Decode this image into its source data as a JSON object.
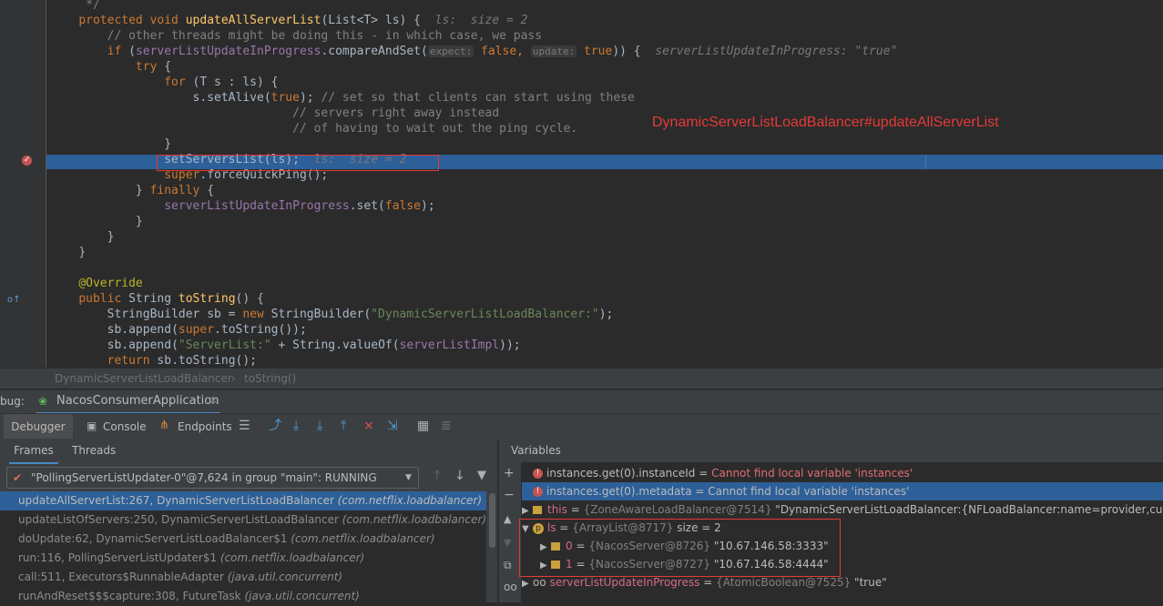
{
  "editor": {
    "lines": [
      {
        "indent": "     ",
        "parts": [
          {
            "t": "*/",
            "c": "cmt"
          }
        ]
      },
      {
        "indent": "    ",
        "parts": [
          {
            "t": "protected void ",
            "c": "kw"
          },
          {
            "t": "updateAllServerList",
            "c": "fn"
          },
          {
            "t": "(List<T> ls) {  ",
            "c": ""
          },
          {
            "t": "ls:  size = 2",
            "c": "inl"
          }
        ]
      },
      {
        "indent": "        ",
        "parts": [
          {
            "t": "// other threads might be doing this - in which case, we pass",
            "c": "cmt"
          }
        ]
      },
      {
        "indent": "        ",
        "parts": [
          {
            "t": "if ",
            "c": "kw"
          },
          {
            "t": "(",
            "c": ""
          },
          {
            "t": "serverListUpdateInProgress",
            "c": "fld"
          },
          {
            "t": ".compareAndSet(",
            "c": ""
          },
          {
            "t": "expect:",
            "c": "hint"
          },
          {
            "t": " false, ",
            "c": "kw"
          },
          {
            "t": "update:",
            "c": "hint"
          },
          {
            "t": " true",
            "c": "kw"
          },
          {
            "t": ")) {  ",
            "c": ""
          },
          {
            "t": "serverListUpdateInProgress: \"true\"",
            "c": "inl"
          }
        ]
      },
      {
        "indent": "            ",
        "parts": [
          {
            "t": "try ",
            "c": "kw"
          },
          {
            "t": "{",
            "c": ""
          }
        ]
      },
      {
        "indent": "                ",
        "parts": [
          {
            "t": "for ",
            "c": "kw"
          },
          {
            "t": "(T s : ls) {",
            "c": ""
          }
        ]
      },
      {
        "indent": "                    ",
        "parts": [
          {
            "t": "s.setAlive(",
            "c": ""
          },
          {
            "t": "true",
            "c": "kw"
          },
          {
            "t": "); ",
            "c": ""
          },
          {
            "t": "// set so that clients can start using these",
            "c": "cmt"
          }
        ]
      },
      {
        "indent": "                                  ",
        "parts": [
          {
            "t": "// servers right away instead",
            "c": "cmt"
          }
        ]
      },
      {
        "indent": "                                  ",
        "parts": [
          {
            "t": "// of having to wait out the ping cycle.",
            "c": "cmt"
          }
        ]
      },
      {
        "indent": "                ",
        "parts": [
          {
            "t": "}",
            "c": ""
          }
        ]
      },
      {
        "indent": "                ",
        "parts": [
          {
            "t": "setServersList(ls);  ",
            "c": ""
          },
          {
            "t": "ls:  size = 2",
            "c": "inl"
          }
        ]
      },
      {
        "indent": "                ",
        "parts": [
          {
            "t": "super",
            "c": "kw"
          },
          {
            "t": ".forceQuickPing();",
            "c": ""
          }
        ]
      },
      {
        "indent": "            ",
        "parts": [
          {
            "t": "} ",
            "c": ""
          },
          {
            "t": "finally ",
            "c": "kw"
          },
          {
            "t": "{",
            "c": ""
          }
        ]
      },
      {
        "indent": "                ",
        "parts": [
          {
            "t": "serverListUpdateInProgress",
            "c": "fld"
          },
          {
            "t": ".set(",
            "c": ""
          },
          {
            "t": "false",
            "c": "kw"
          },
          {
            "t": ");",
            "c": ""
          }
        ]
      },
      {
        "indent": "            ",
        "parts": [
          {
            "t": "}",
            "c": ""
          }
        ]
      },
      {
        "indent": "        ",
        "parts": [
          {
            "t": "}",
            "c": ""
          }
        ]
      },
      {
        "indent": "    ",
        "parts": [
          {
            "t": "}",
            "c": ""
          }
        ]
      },
      {
        "indent": "",
        "parts": [
          {
            "t": "",
            "c": ""
          }
        ]
      },
      {
        "indent": "    ",
        "parts": [
          {
            "t": "@Override",
            "c": "ann"
          }
        ]
      },
      {
        "indent": "    ",
        "parts": [
          {
            "t": "public ",
            "c": "kw"
          },
          {
            "t": "String ",
            "c": ""
          },
          {
            "t": "toString",
            "c": "fn"
          },
          {
            "t": "() {",
            "c": ""
          }
        ]
      },
      {
        "indent": "        ",
        "parts": [
          {
            "t": "StringBuilder sb = ",
            "c": ""
          },
          {
            "t": "new ",
            "c": "kw"
          },
          {
            "t": "StringBuilder(",
            "c": ""
          },
          {
            "t": "\"DynamicServerListLoadBalancer:\"",
            "c": "str"
          },
          {
            "t": ");",
            "c": ""
          }
        ]
      },
      {
        "indent": "        ",
        "parts": [
          {
            "t": "sb.append(",
            "c": ""
          },
          {
            "t": "super",
            "c": "kw"
          },
          {
            "t": ".toString());",
            "c": ""
          }
        ]
      },
      {
        "indent": "        ",
        "parts": [
          {
            "t": "sb.append(",
            "c": ""
          },
          {
            "t": "\"ServerList:\"",
            "c": "str"
          },
          {
            "t": " + String.",
            "c": ""
          },
          {
            "t": "valueOf",
            "c": ""
          },
          {
            "t": "(",
            "c": ""
          },
          {
            "t": "serverListImpl",
            "c": "fld"
          },
          {
            "t": "));",
            "c": ""
          }
        ]
      },
      {
        "indent": "        ",
        "parts": [
          {
            "t": "return ",
            "c": "kw"
          },
          {
            "t": "sb.toString();",
            "c": ""
          }
        ]
      }
    ],
    "annotation": "DynamicServerListLoadBalancer#updateAllServerList"
  },
  "breadcrumb": {
    "class_name": "DynamicServerListLoadBalancer",
    "sep": "›",
    "method": "toString()"
  },
  "debug": {
    "label": "bug:",
    "session": "NacosConsumerApplication",
    "close": "×"
  },
  "toolbar": {
    "debugger": "Debugger",
    "console": "Console",
    "endpoints": "Endpoints"
  },
  "frames_panel": {
    "tab_frames": "Frames",
    "tab_threads": "Threads",
    "thread": "\"PollingServerListUpdater-0\"@7,624 in group \"main\": RUNNING",
    "frames": [
      {
        "method": "updateAllServerList:267, DynamicServerListLoadBalancer ",
        "pkg": "(com.netflix.loadbalancer)",
        "selected": true
      },
      {
        "method": "updateListOfServers:250, DynamicServerListLoadBalancer ",
        "pkg": "(com.netflix.loadbalancer)",
        "selected": false
      },
      {
        "method": "doUpdate:62, DynamicServerListLoadBalancer$1 ",
        "pkg": "(com.netflix.loadbalancer)",
        "selected": false
      },
      {
        "method": "run:116, PollingServerListUpdater$1 ",
        "pkg": "(com.netflix.loadbalancer)",
        "selected": false
      },
      {
        "method": "call:511, Executors$RunnableAdapter ",
        "pkg": "(java.util.concurrent)",
        "selected": false
      },
      {
        "method": "runAndReset$$$capture:308, FutureTask ",
        "pkg": "(java.util.concurrent)",
        "selected": false
      }
    ]
  },
  "variables": {
    "title": "Variables",
    "rows": [
      {
        "expr": "instances.get(0).instanceId",
        "eq": " = ",
        "msg": "Cannot find local variable 'instances'"
      },
      {
        "expr": "instances.get(0).metadata",
        "eq": " = ",
        "msg": "Cannot find local variable 'instances'"
      },
      {
        "name": "this",
        "eq": " = ",
        "ref": "{ZoneAwareLoadBalancer@7514}",
        "val": " \"DynamicServerListLoadBalancer:{NFLoadBalancer:name=provider,current"
      },
      {
        "name": "ls",
        "eq": " = ",
        "ref": "{ArrayList@8717}",
        "val": "  size = 2"
      },
      {
        "name": "0",
        "eq": " = ",
        "ref": "{NacosServer@8726}",
        "val": " \"10.67.146.58:3333\""
      },
      {
        "name": "1",
        "eq": " = ",
        "ref": "{NacosServer@8727}",
        "val": " \"10.67.146.58:4444\""
      },
      {
        "name": "serverListUpdateInProgress",
        "eq": " = ",
        "ref": "{AtomicBoolean@7525}",
        "val": " \"true\""
      }
    ]
  }
}
